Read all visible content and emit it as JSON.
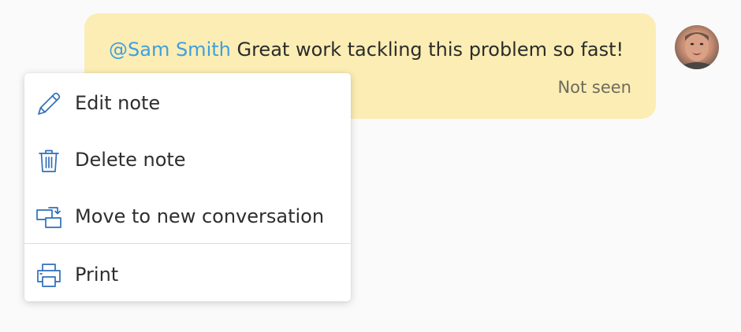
{
  "note": {
    "mention": "@Sam Smith",
    "message": " Great work tackling this problem so fast!",
    "status": "Not seen",
    "background_color": "#fbedb3",
    "mention_color": "#3f9fe0"
  },
  "avatar": {
    "icon": "user-avatar-photo"
  },
  "context_menu": {
    "items": [
      {
        "label": "Edit note",
        "icon": "pencil-icon"
      },
      {
        "label": "Delete note",
        "icon": "trash-icon"
      },
      {
        "label": "Move to new conversation",
        "icon": "move-conversation-icon"
      },
      {
        "label": "Print",
        "icon": "printer-icon"
      }
    ],
    "icon_color": "#2f6fbb"
  }
}
